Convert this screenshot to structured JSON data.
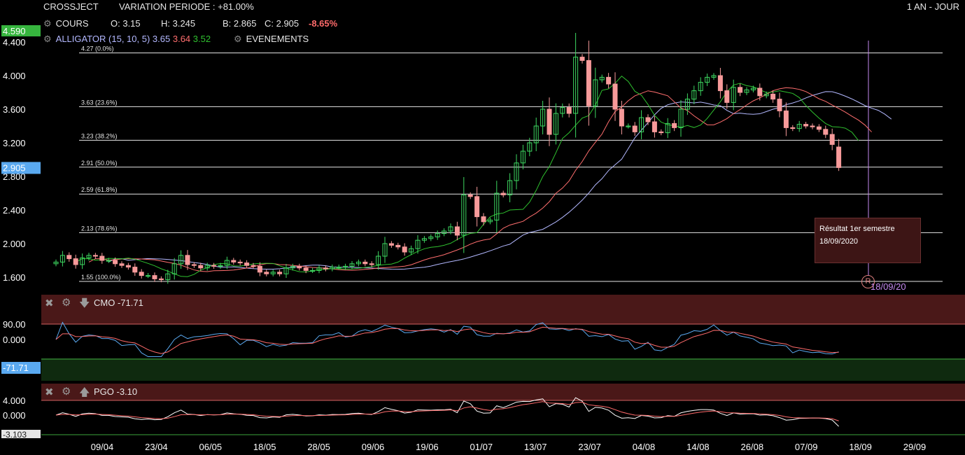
{
  "header": {
    "ticker": "CROSSJECT",
    "variation": "VARIATION PERIODE : +81.00%",
    "period": "1 AN - JOUR",
    "cours_label": "COURS",
    "open": "O: 3.15",
    "high": "H: 3.245",
    "low": "B: 2.865",
    "close": "C: 2.905",
    "change": "-8.65%",
    "alligator_label": "ALLIGATOR (15, 10, 5)",
    "alligator_v1": "3.65",
    "alligator_v2": "3.64",
    "alligator_v3": "3.52",
    "events_label": "EVENEMENTS"
  },
  "colors": {
    "up": "#3dd660",
    "down": "#f79a9a",
    "jaw": "#b3b8ff",
    "teeth": "#ff6e6e",
    "lips": "#2fc12f",
    "fib": "#e6e6e6",
    "signal": "#ff6b6b",
    "cmo_line": "#5aa9f0",
    "pgo_line": "#ffffff",
    "band_high": "#4a1818",
    "band_low": "#0f2a0f",
    "price_tag": "#5aa9f0",
    "high_tag": "#36b53e"
  },
  "price_axis": {
    "ticks": [
      "4.400",
      "4.000",
      "3.600",
      "3.200",
      "2.800",
      "2.400",
      "2.000",
      "1.600"
    ],
    "high_tag": "4.590",
    "last_tag": "2.905"
  },
  "fib_levels": [
    {
      "value": 4.27,
      "label": "4.27 (0.0%)"
    },
    {
      "value": 3.63,
      "label": "3.63 (23.6%)"
    },
    {
      "value": 3.23,
      "label": "3.23 (38.2%)"
    },
    {
      "value": 2.91,
      "label": "2.91 (50.0%)"
    },
    {
      "value": 2.59,
      "label": "2.59 (61.8%)"
    },
    {
      "value": 2.13,
      "label": "2.13 (78.6%)"
    },
    {
      "value": 1.55,
      "label": "1.55 (100.0%)"
    }
  ],
  "event": {
    "title": "Résultat 1er semestre",
    "date": "18/09/2020",
    "marker": "R",
    "marker_label": "18/09/20"
  },
  "cmo": {
    "label": "CMO -71.71",
    "ticks": [
      "90.00",
      "0.000"
    ],
    "last_tag": "-71.71"
  },
  "pgo": {
    "label": "PGO -3.10",
    "ticks": [
      "4.000",
      "0.000"
    ],
    "last_tag": "-3.103"
  },
  "x_axis": [
    "09/04",
    "23/04",
    "06/05",
    "18/05",
    "28/05",
    "09/06",
    "19/06",
    "01/07",
    "13/07",
    "23/07",
    "04/08",
    "14/08",
    "26/08",
    "07/09",
    "18/09",
    "29/09"
  ],
  "chart_data": {
    "type": "candlestick",
    "title": "CROSSJECT",
    "ylim": [
      1.55,
      4.59
    ],
    "series": [
      {
        "name": "COURS",
        "close": [
          1.78,
          1.86,
          1.82,
          1.75,
          1.83,
          1.86,
          1.85,
          1.8,
          1.8,
          1.76,
          1.74,
          1.72,
          1.66,
          1.62,
          1.62,
          1.58,
          1.57,
          1.64,
          1.76,
          1.86,
          1.75,
          1.74,
          1.71,
          1.74,
          1.73,
          1.74,
          1.8,
          1.78,
          1.77,
          1.74,
          1.73,
          1.66,
          1.64,
          1.66,
          1.64,
          1.71,
          1.73,
          1.71,
          1.68,
          1.68,
          1.71,
          1.7,
          1.72,
          1.72,
          1.73,
          1.76,
          1.78,
          1.76,
          1.75,
          1.85,
          2.0,
          1.98,
          1.96,
          1.9,
          1.94,
          2.04,
          2.06,
          2.08,
          2.12,
          2.15,
          2.2,
          2.1,
          2.58,
          2.56,
          2.32,
          2.26,
          2.28,
          2.6,
          2.58,
          2.75,
          2.96,
          3.1,
          3.2,
          3.4,
          3.6,
          3.3,
          3.55,
          3.62,
          3.55,
          4.22,
          4.18,
          3.64,
          3.95,
          3.98,
          3.9,
          3.6,
          3.4,
          3.4,
          3.33,
          3.5,
          3.45,
          3.33,
          3.32,
          3.43,
          3.38,
          3.6,
          3.72,
          3.82,
          3.92,
          3.98,
          4.0,
          3.82,
          3.68,
          3.86,
          3.8,
          3.83,
          3.85,
          3.76,
          3.78,
          3.72,
          3.58,
          3.38,
          3.37,
          3.42,
          3.4,
          3.39,
          3.36,
          3.3,
          3.18,
          2.905
        ]
      },
      {
        "name": "ALLIGATOR jaw",
        "last": 3.65
      },
      {
        "name": "ALLIGATOR teeth",
        "last": 3.64
      },
      {
        "name": "ALLIGATOR lips",
        "last": 3.52
      }
    ],
    "x_ticks": [
      "09/04",
      "23/04",
      "06/05",
      "18/05",
      "28/05",
      "09/06",
      "19/06",
      "01/07",
      "13/07",
      "23/07",
      "04/08",
      "14/08",
      "26/08",
      "07/09",
      "18/09",
      "29/09"
    ],
    "last": {
      "open": 3.15,
      "high": 3.245,
      "low": 2.865,
      "close": 2.905,
      "change_pct": -8.65
    }
  }
}
